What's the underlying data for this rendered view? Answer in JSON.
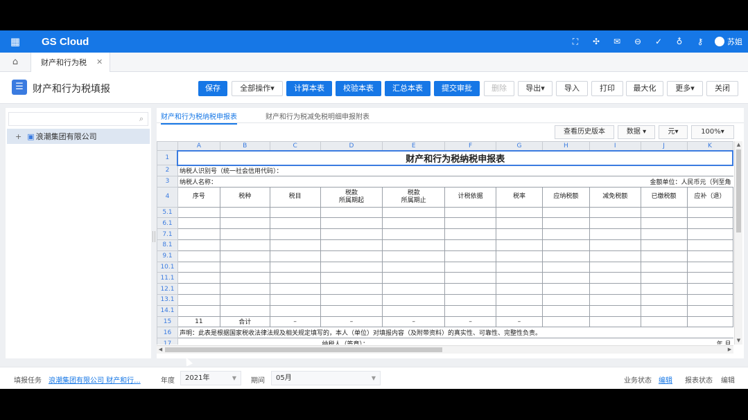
{
  "app": {
    "brand": "GS Cloud",
    "user": "苏姐"
  },
  "tabstrip": {
    "tab_label": "财产和行为税"
  },
  "page": {
    "title": "财产和行为税填报"
  },
  "toolbar": {
    "save": "保存",
    "all_ops": "全部操作▾",
    "calc": "计算本表",
    "check": "校验本表",
    "summary": "汇总本表",
    "submit": "提交审批",
    "delete": "删除",
    "export": "导出▾",
    "import": "导入",
    "print": "打印",
    "maximize": "最大化",
    "more": "更多▾",
    "close": "关闭"
  },
  "tree": {
    "root": "浪潮集团有限公司"
  },
  "sheet_tabs": [
    "财产和行为税纳税申报表",
    "财产和行为税减免税明细申报附表"
  ],
  "sheet_toolbar": {
    "history": "查看历史版本",
    "data": "数据 ▾",
    "unit": "元▾",
    "zoom": "100%▾"
  },
  "grid": {
    "columns": [
      "A",
      "B",
      "C",
      "D",
      "E",
      "F",
      "G",
      "H",
      "I",
      "J",
      "K"
    ],
    "title": "财产和行为税纳税申报表",
    "row2": "纳税人识别号（统一社会信用代码）：",
    "row3_left": "纳税人名称：",
    "row3_right": "金额单位：人民币元（列至角",
    "headers": [
      "序号",
      "税种",
      "税目",
      "税款\n所属期起",
      "税款\n所属期止",
      "计税依据",
      "税率",
      "应纳税额",
      "减免税额",
      "已缴税额",
      "应补（退）"
    ],
    "data_rows": [
      "5.1",
      "6.1",
      "7.1",
      "8.1",
      "9.1",
      "10.1",
      "11.1",
      "12.1",
      "13.1",
      "14.1"
    ],
    "row15": [
      "11",
      "合计",
      "–",
      "–",
      "–",
      "–",
      "–"
    ],
    "row16": "声明：此表是根据国家税收法律法规及相关规定填写的，本人（单位）对填报内容（及附带资料）的真实性、可靠性、完整性负责。",
    "row17": "纳税人（签章）：",
    "row17_right": "年    月"
  },
  "footer": {
    "task_label": "填报任务",
    "task_value": "浪潮集团有限公司 财产和行...",
    "year_label": "年度",
    "year_value": "2021年",
    "period_label": "期间",
    "period_value": "05月",
    "biz_status_label": "业务状态",
    "biz_status_value": "编辑",
    "report_status_label": "报表状态",
    "report_status_value": "编辑"
  }
}
